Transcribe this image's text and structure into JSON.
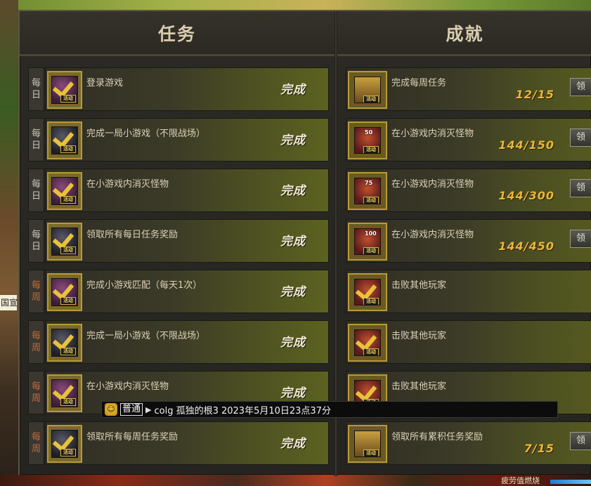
{
  "window": {
    "left_tab": "任务",
    "right_tab": "成就"
  },
  "colors": {
    "daily": "#c8c4b8",
    "weekly": "#c46a38",
    "progress": "#e8b838"
  },
  "tasks": [
    {
      "category": [
        "每",
        "日"
      ],
      "type": "daily",
      "title": "登录游戏",
      "status": "完成",
      "icon": "checkmark-badge-icon",
      "badge": "活动"
    },
    {
      "category": [
        "每",
        "日"
      ],
      "type": "daily",
      "title": "完成一局小游戏（不限战场）",
      "status": "完成",
      "icon": "checkmark-badge-icon",
      "badge": "活动"
    },
    {
      "category": [
        "每",
        "日"
      ],
      "type": "daily",
      "title": "在小游戏内消灭怪物",
      "status": "完成",
      "icon": "checkmark-badge-icon",
      "badge": "活动"
    },
    {
      "category": [
        "每",
        "日"
      ],
      "type": "daily",
      "title": "领取所有每日任务奖励",
      "status": "完成",
      "icon": "checkmark-badge-icon",
      "badge": "活动"
    },
    {
      "category": [
        "每",
        "周"
      ],
      "type": "weekly",
      "title": "完成小游戏匹配（每天1次）",
      "status": "完成",
      "icon": "checkmark-badge-icon",
      "badge": "活动"
    },
    {
      "category": [
        "每",
        "周"
      ],
      "type": "weekly",
      "title": "完成一局小游戏（不限战场）",
      "status": "完成",
      "icon": "checkmark-badge-icon",
      "badge": "活动"
    },
    {
      "category": [
        "每",
        "周"
      ],
      "type": "weekly",
      "title": "在小游戏内消灭怪物",
      "status": "完成",
      "icon": "checkmark-badge-icon",
      "badge": "活动"
    },
    {
      "category": [
        "每",
        "周"
      ],
      "type": "weekly",
      "title": "领取所有每周任务奖励",
      "status": "完成",
      "icon": "checkmark-badge-icon",
      "badge": "活动"
    }
  ],
  "achievements": [
    {
      "title": "完成每周任务",
      "progress": "12/15",
      "claim": "领",
      "icon": "chest-badge-icon",
      "badge": "活动",
      "num": ""
    },
    {
      "title": "在小游戏内消灭怪物",
      "progress": "144/150",
      "claim": "领",
      "icon": "monster-badge-icon",
      "badge": "活动",
      "num": "50"
    },
    {
      "title": "在小游戏内消灭怪物",
      "progress": "144/300",
      "claim": "领",
      "icon": "monster-badge-icon",
      "badge": "活动",
      "num": "75"
    },
    {
      "title": "在小游戏内消灭怪物",
      "progress": "144/450",
      "claim": "领",
      "icon": "monster-badge-icon",
      "badge": "活动",
      "num": "100"
    },
    {
      "title": "击败其他玩家",
      "progress": "",
      "claim": "",
      "icon": "checkmark-badge-icon",
      "badge": "活动",
      "num": ""
    },
    {
      "title": "击败其他玩家",
      "progress": "",
      "claim": "",
      "icon": "checkmark-badge-icon",
      "badge": "活动",
      "num": ""
    },
    {
      "title": "击败其他玩家",
      "progress": "",
      "claim": "",
      "icon": "checkmark-badge-icon",
      "badge": "活动",
      "num": ""
    },
    {
      "title": "领取所有累积任务奖励",
      "progress": "7/15",
      "claim": "领",
      "icon": "chest-badge-icon",
      "badge": "活动",
      "num": ""
    }
  ],
  "chat": {
    "channel": "普通",
    "message": "colg 孤独的根3 2023年5月10日23点37分"
  },
  "left_edge_text": "国宣",
  "status_bar": {
    "text": "疲劳值燃烧"
  }
}
